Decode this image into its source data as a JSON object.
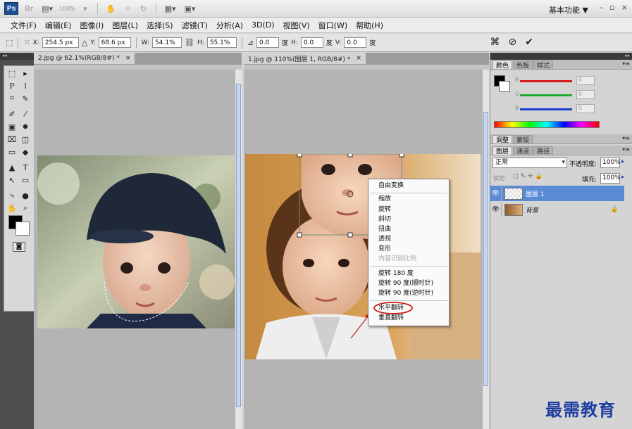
{
  "app": {
    "logo": "Ps",
    "zoom_display": "100%",
    "workspace": "基本功能",
    "workspace_arrow": "▼",
    "window_controls": [
      "–",
      "▫",
      "×"
    ]
  },
  "menu": [
    "文件(F)",
    "编辑(E)",
    "图像(I)",
    "图层(L)",
    "选择(S)",
    "滤镜(T)",
    "分析(A)",
    "3D(D)",
    "视图(V)",
    "窗口(W)",
    "帮助(H)"
  ],
  "options": {
    "x_label": "X:",
    "x_value": "254.5 px",
    "y_label": "Y:",
    "y_value": "68.6 px",
    "w_label": "W:",
    "w_value": "54.1%",
    "h_label": "H:",
    "h_value": "55.1%",
    "rot_value": "0.0",
    "rot_unit": "度",
    "hskew_label": "H:",
    "hskew_value": "0.0",
    "hskew_unit": "度",
    "vskew_label": "V:",
    "vskew_value": "0.0",
    "vskew_unit": "度"
  },
  "tools": [
    "⬚",
    "▸",
    "ℙ",
    "⌇",
    "⌗",
    "✎",
    "✐",
    "⁄",
    "▣",
    "✹",
    "⌧",
    "◫",
    "▭",
    "◆",
    "▲",
    "●",
    "⤷",
    "T",
    "↖",
    "▭",
    "✋",
    "⌕"
  ],
  "docs": [
    {
      "title": "2.jpg @ 62.1%(RGB/8#) *",
      "close": "×"
    },
    {
      "title": "1.jpg @ 110%(图层 1, RGB/8#) *",
      "close": "×"
    }
  ],
  "color_panel": {
    "tabs": [
      "颜色",
      "色板",
      "样式"
    ],
    "channels": [
      {
        "label": "R",
        "color": "#d21b1b",
        "value": "0"
      },
      {
        "label": "G",
        "color": "#1ea92e",
        "value": "0"
      },
      {
        "label": "B",
        "color": "#1c3fd2",
        "value": "0"
      }
    ]
  },
  "adjust_panel": {
    "tabs": [
      "调整",
      "蒙版"
    ]
  },
  "layers_panel": {
    "tabs": [
      "图层",
      "通道",
      "路径"
    ],
    "blend_mode": "正常",
    "opacity_label": "不透明度:",
    "opacity_value": "100%",
    "lock_label": "锁定:",
    "fill_label": "填充:",
    "fill_value": "100%",
    "layers": [
      {
        "name": "图层 1",
        "selected": true,
        "locked": false
      },
      {
        "name": "背景",
        "selected": false,
        "locked": true
      }
    ]
  },
  "context_menu": {
    "items": [
      {
        "label": "自由变换",
        "enabled": true
      },
      {
        "label": "缩放",
        "enabled": true
      },
      {
        "label": "旋转",
        "enabled": true
      },
      {
        "label": "斜切",
        "enabled": true
      },
      {
        "label": "扭曲",
        "enabled": true
      },
      {
        "label": "透视",
        "enabled": true
      },
      {
        "label": "变形",
        "enabled": true
      },
      {
        "label": "内容识别比例",
        "enabled": false
      },
      {
        "label": "旋转 180 度",
        "enabled": true
      },
      {
        "label": "旋转 90 度(顺时针)",
        "enabled": true
      },
      {
        "label": "旋转 90 度(逆时针)",
        "enabled": true
      },
      {
        "label": "水平翻转",
        "enabled": true,
        "highlighted": true
      },
      {
        "label": "垂直翻转",
        "enabled": true
      }
    ]
  },
  "watermark": "最需教育",
  "colors": {
    "highlight_ring": "#c81e1e",
    "selected_layer": "#5a8bd6"
  }
}
